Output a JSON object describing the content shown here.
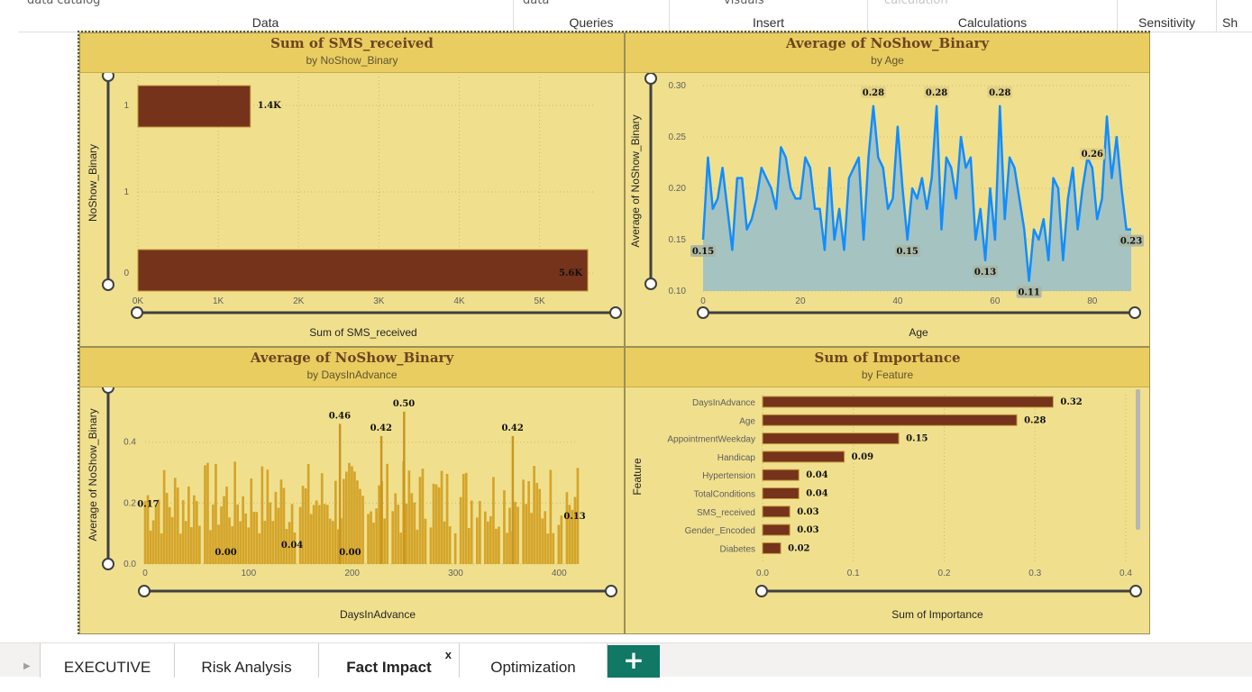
{
  "ribbon": {
    "groups": [
      {
        "label": "Data",
        "cut_text": "data    catalog"
      },
      {
        "label": "Queries",
        "cut_text": "data"
      },
      {
        "label": "Insert",
        "cut_text": "visuals"
      },
      {
        "label": "Calculations",
        "cut_text": "calculation"
      },
      {
        "label": "Sensitivity",
        "cut_text": ""
      },
      {
        "label": "Sh",
        "cut_text": ""
      }
    ]
  },
  "visuals": {
    "sms": {
      "title": "Sum of SMS_received",
      "subtitle": "by NoShow_Binary",
      "xlabel": "Sum of SMS_received",
      "ylabel": "NoShow_Binary"
    },
    "age": {
      "title": "Average of NoShow_Binary",
      "subtitle": "by Age",
      "xlabel": "Age",
      "ylabel": "Average of NoShow_Binary"
    },
    "days": {
      "title": "Average of NoShow_Binary",
      "subtitle": "by DaysInAdvance",
      "xlabel": "DaysInAdvance",
      "ylabel": "Average of NoShow_Binary"
    },
    "importance": {
      "title": "Sum of Importance",
      "subtitle": "by Feature",
      "xlabel": "Sum of Importance",
      "ylabel": "Feature"
    }
  },
  "tabs": [
    {
      "label": "EXECUTIVE",
      "active": false
    },
    {
      "label": "Risk Analysis",
      "active": false
    },
    {
      "label": "Fact Impact",
      "active": true,
      "close": "x"
    },
    {
      "label": "Optimization",
      "active": false
    }
  ],
  "add_page_label": "+",
  "colors": {
    "bar_brown": "#75331c",
    "line_blue": "#118dff",
    "area_fill": "#9cc0c6",
    "gold_bar": "#d4a52b",
    "header_gold": "#e9cd60",
    "panel": "#f0e08e",
    "add_tab": "#117865"
  },
  "chart_data": [
    {
      "type": "bar",
      "orientation": "horizontal",
      "title": "Sum of SMS_received",
      "subtitle": "by NoShow_Binary",
      "xlabel": "Sum of SMS_received",
      "ylabel": "NoShow_Binary",
      "categories": [
        "1",
        "1",
        "0"
      ],
      "values": [
        1400,
        null,
        5600
      ],
      "data_labels": [
        "1.4K",
        "",
        "5.6K"
      ],
      "x_ticks": [
        "0K",
        "1K",
        "2K",
        "3K",
        "4K",
        "5K"
      ],
      "xlim": [
        0,
        5700
      ]
    },
    {
      "type": "line",
      "title": "Average of NoShow_Binary",
      "subtitle": "by Age",
      "xlabel": "Age",
      "ylabel": "Average of NoShow_Binary",
      "x": [
        0,
        1,
        2,
        3,
        4,
        5,
        6,
        7,
        8,
        9,
        10,
        11,
        12,
        13,
        14,
        15,
        16,
        17,
        18,
        19,
        20,
        21,
        22,
        23,
        24,
        25,
        26,
        27,
        28,
        29,
        30,
        31,
        32,
        33,
        34,
        35,
        36,
        37,
        38,
        39,
        40,
        41,
        42,
        43,
        44,
        45,
        46,
        47,
        48,
        49,
        50,
        51,
        52,
        53,
        54,
        55,
        56,
        57,
        58,
        59,
        60,
        61,
        62,
        63,
        64,
        65,
        66,
        67,
        68,
        69,
        70,
        71,
        72,
        73,
        74,
        75,
        76,
        77,
        78,
        79,
        80,
        81,
        82,
        83,
        84,
        85,
        86,
        87,
        88
      ],
      "values": [
        0.15,
        0.23,
        0.18,
        0.19,
        0.22,
        0.18,
        0.14,
        0.21,
        0.21,
        0.16,
        0.17,
        0.19,
        0.22,
        0.21,
        0.2,
        0.18,
        0.24,
        0.23,
        0.2,
        0.19,
        0.19,
        0.23,
        0.22,
        0.18,
        0.18,
        0.14,
        0.22,
        0.15,
        0.18,
        0.14,
        0.21,
        0.22,
        0.23,
        0.15,
        0.23,
        0.28,
        0.23,
        0.22,
        0.18,
        0.19,
        0.26,
        0.2,
        0.15,
        0.2,
        0.19,
        0.21,
        0.18,
        0.21,
        0.28,
        0.16,
        0.23,
        0.22,
        0.19,
        0.25,
        0.22,
        0.23,
        0.15,
        0.18,
        0.13,
        0.2,
        0.15,
        0.28,
        0.17,
        0.23,
        0.22,
        0.19,
        0.16,
        0.11,
        0.16,
        0.15,
        0.17,
        0.13,
        0.21,
        0.2,
        0.13,
        0.19,
        0.22,
        0.16,
        0.2,
        0.23,
        0.22,
        0.17,
        0.19,
        0.27,
        0.21,
        0.25,
        0.2,
        0.16,
        0.16,
        0.23
      ],
      "data_labels": [
        {
          "x": 0,
          "label": "0.15"
        },
        {
          "x": 35,
          "label": "0.28"
        },
        {
          "x": 42,
          "label": "0.15"
        },
        {
          "x": 48,
          "label": "0.28"
        },
        {
          "x": 58,
          "label": "0.13"
        },
        {
          "x": 61,
          "label": "0.28"
        },
        {
          "x": 67,
          "label": "0.11"
        },
        {
          "x": 80,
          "label": "0.26"
        },
        {
          "x": 88,
          "label": "0.23"
        }
      ],
      "x_ticks": [
        0,
        20,
        40,
        60,
        80
      ],
      "y_ticks": [
        "0.10",
        "0.15",
        "0.20",
        "0.25",
        "0.30"
      ],
      "xlim": [
        0,
        88
      ],
      "ylim": [
        0.1,
        0.3
      ]
    },
    {
      "type": "bar",
      "title": "Average of NoShow_Binary",
      "subtitle": "by DaysInAdvance",
      "xlabel": "DaysInAdvance",
      "ylabel": "Average of NoShow_Binary",
      "x_range": [
        0,
        418
      ],
      "data_labels": [
        {
          "x": 3,
          "value": 0.17,
          "label": "0.17"
        },
        {
          "x": 78,
          "value": 0.0,
          "label": "0.00"
        },
        {
          "x": 142,
          "value": 0.04,
          "label": "0.04"
        },
        {
          "x": 188,
          "value": 0.46,
          "label": "0.46"
        },
        {
          "x": 198,
          "value": 0.0,
          "label": "0.00"
        },
        {
          "x": 228,
          "value": 0.42,
          "label": "0.42"
        },
        {
          "x": 250,
          "value": 0.5,
          "label": "0.50"
        },
        {
          "x": 355,
          "value": 0.42,
          "label": "0.42"
        },
        {
          "x": 415,
          "value": 0.13,
          "label": "0.13"
        }
      ],
      "x_ticks": [
        0,
        100,
        200,
        300,
        400
      ],
      "y_ticks": [
        "0.0",
        "0.2",
        "0.4"
      ],
      "ylim": [
        0,
        0.55
      ]
    },
    {
      "type": "bar",
      "orientation": "horizontal",
      "title": "Sum of Importance",
      "subtitle": "by Feature",
      "xlabel": "Sum of Importance",
      "ylabel": "Feature",
      "categories": [
        "DaysInAdvance",
        "Age",
        "AppointmentWeekday",
        "Handicap",
        "Hypertension",
        "TotalConditions",
        "SMS_received",
        "Gender_Encoded",
        "Diabetes"
      ],
      "values": [
        0.32,
        0.28,
        0.15,
        0.09,
        0.04,
        0.04,
        0.03,
        0.03,
        0.02
      ],
      "x_ticks": [
        "0.0",
        "0.1",
        "0.2",
        "0.3",
        "0.4"
      ],
      "xlim": [
        0,
        0.4
      ]
    }
  ]
}
